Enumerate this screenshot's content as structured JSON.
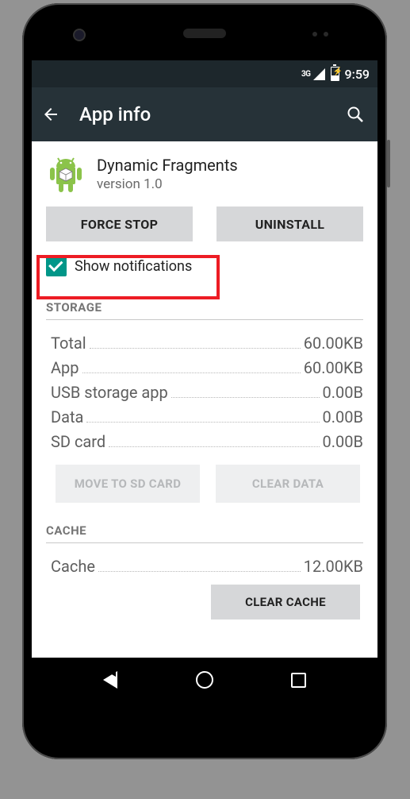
{
  "statusbar": {
    "network": "3G",
    "time": "9:59"
  },
  "actionbar": {
    "title": "App info"
  },
  "app": {
    "name": "Dynamic Fragments",
    "version": "version 1.0"
  },
  "buttons": {
    "force_stop": "FORCE STOP",
    "uninstall": "UNINSTALL",
    "move_sd": "MOVE TO SD CARD",
    "clear_data": "CLEAR DATA",
    "clear_cache": "CLEAR CACHE"
  },
  "checkbox": {
    "label": "Show notifications",
    "checked": true
  },
  "sections": {
    "storage": "STORAGE",
    "cache": "CACHE"
  },
  "storage": {
    "rows": [
      {
        "k": "Total",
        "v": "60.00KB"
      },
      {
        "k": "App",
        "v": "60.00KB"
      },
      {
        "k": "USB storage app",
        "v": "0.00B"
      },
      {
        "k": "Data",
        "v": "0.00B"
      },
      {
        "k": "SD card",
        "v": "0.00B"
      }
    ]
  },
  "cache": {
    "rows": [
      {
        "k": "Cache",
        "v": "12.00KB"
      }
    ]
  }
}
